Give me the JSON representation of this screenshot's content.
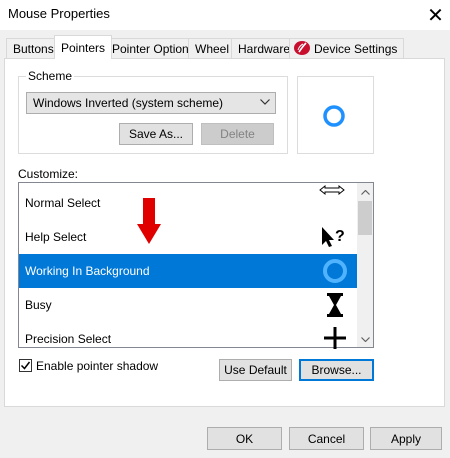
{
  "window": {
    "title": "Mouse Properties",
    "close_symbol": "✕"
  },
  "tabs": [
    {
      "label": "Buttons"
    },
    {
      "label": "Pointers"
    },
    {
      "label": "Pointer Options"
    },
    {
      "label": "Wheel"
    },
    {
      "label": "Hardware"
    },
    {
      "label": "Device Settings"
    }
  ],
  "scheme": {
    "label": "Scheme",
    "selected": "Windows Inverted (system scheme)",
    "save_as_label": "Save As...",
    "delete_label": "Delete"
  },
  "customize": {
    "label": "Customize:",
    "items": [
      {
        "label": "Normal Select",
        "icon": "pointer-arrow-icon"
      },
      {
        "label": "Help Select",
        "icon": "help-select-icon"
      },
      {
        "label": "Working In Background",
        "icon": "busy-ring-icon"
      },
      {
        "label": "Busy",
        "icon": "hourglass-icon"
      },
      {
        "label": "Precision Select",
        "icon": "crosshair-icon"
      }
    ],
    "selected_index": 2
  },
  "enable_shadow": {
    "label": "Enable pointer shadow",
    "checked": true
  },
  "buttons": {
    "use_default": "Use Default",
    "browse": "Browse...",
    "ok": "OK",
    "cancel": "Cancel",
    "apply": "Apply"
  },
  "colors": {
    "accent": "#0078d7",
    "annotation_arrow": "#e00000",
    "device_settings_icon": "#c8102e"
  }
}
